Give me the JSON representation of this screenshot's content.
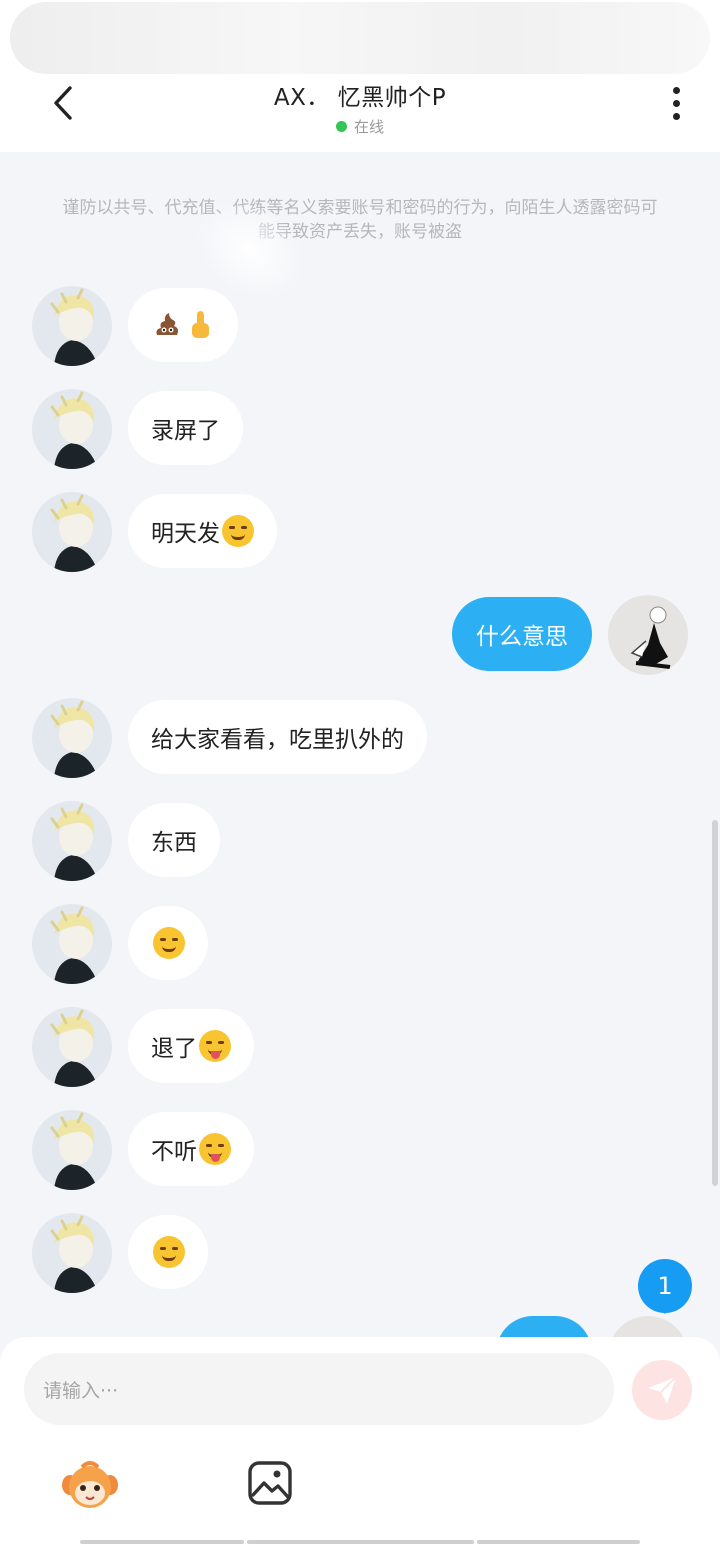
{
  "header": {
    "title": "AX．  忆黑帅个P",
    "status": "在线"
  },
  "notice": "谨防以共号、代充值、代练等名义索要账号和密码的行为，向陌生人透露密码可能导致资产丢失，账号被盗",
  "messages": [
    {
      "side": "left",
      "text": "",
      "emoji": [
        "poop-emoji",
        "middle-finger-emoji"
      ]
    },
    {
      "side": "left",
      "text": "录屏了",
      "emoji": []
    },
    {
      "side": "left",
      "text": "明天发",
      "emoji": [
        "smirk-emoji"
      ]
    },
    {
      "side": "right",
      "text": "什么意思",
      "emoji": []
    },
    {
      "side": "left",
      "text": "给大家看看，吃里扒外的",
      "emoji": []
    },
    {
      "side": "left",
      "text": "东西",
      "emoji": []
    },
    {
      "side": "left",
      "text": "",
      "emoji": [
        "smirk-emoji"
      ]
    },
    {
      "side": "left",
      "text": "退了",
      "emoji": [
        "zany-face-emoji"
      ]
    },
    {
      "side": "left",
      "text": "不听",
      "emoji": [
        "zany-face-emoji"
      ]
    },
    {
      "side": "left",
      "text": "",
      "emoji": [
        "smirk-emoji"
      ]
    }
  ],
  "unread_count": "1",
  "input": {
    "placeholder": "请输入···"
  },
  "colors": {
    "accent": "#2cb0f3",
    "online": "#35c455",
    "send_disabled": "#fde3e2",
    "badge": "#169cf2"
  }
}
